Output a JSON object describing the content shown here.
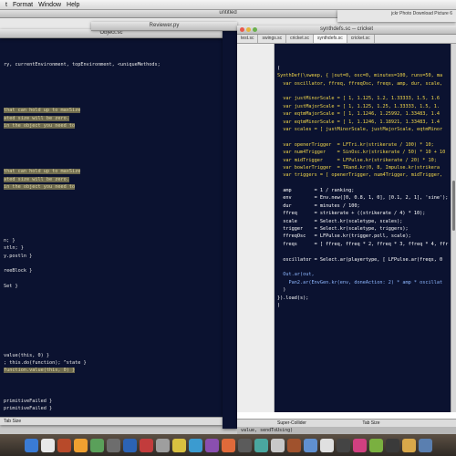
{
  "menu": [
    "t",
    "Format",
    "Window",
    "Help"
  ],
  "background_title": "untitled",
  "right_background_title": "jckr Photo Download  Picture 6",
  "object_window": {
    "title": "Object.sc",
    "lines": [
      {
        "text": "ry, currentEnvironment, topEnvironment, <uniqueMethods;",
        "cls": ""
      },
      {
        "text": "",
        "cls": ""
      },
      {
        "text": "",
        "cls": ""
      },
      {
        "text": "",
        "cls": ""
      },
      {
        "text": "",
        "cls": ""
      },
      {
        "text": "",
        "cls": ""
      },
      {
        "text": "that can hold up to maxSize",
        "cls": "hl"
      },
      {
        "text": "ated size will be zero.",
        "cls": "hl"
      },
      {
        "text": "in the object you need to",
        "cls": "hl"
      },
      {
        "text": "",
        "cls": ""
      },
      {
        "text": "",
        "cls": ""
      },
      {
        "text": "",
        "cls": ""
      },
      {
        "text": "",
        "cls": ""
      },
      {
        "text": "",
        "cls": ""
      },
      {
        "text": "that can hold up to maxSize",
        "cls": "hl"
      },
      {
        "text": "ated size will be zero.",
        "cls": "hl"
      },
      {
        "text": "in the object you need to",
        "cls": "hl"
      },
      {
        "text": "",
        "cls": ""
      },
      {
        "text": "",
        "cls": ""
      },
      {
        "text": "",
        "cls": ""
      },
      {
        "text": "",
        "cls": ""
      },
      {
        "text": "",
        "cls": ""
      },
      {
        "text": "",
        "cls": ""
      },
      {
        "text": "n; }",
        "cls": ""
      },
      {
        "text": "stln; }",
        "cls": ""
      },
      {
        "text": "y.postln }",
        "cls": ""
      },
      {
        "text": "",
        "cls": ""
      },
      {
        "text": "reeBlock }",
        "cls": ""
      },
      {
        "text": "",
        "cls": ""
      },
      {
        "text": "Set }",
        "cls": ""
      },
      {
        "text": "",
        "cls": ""
      },
      {
        "text": "",
        "cls": ""
      },
      {
        "text": "",
        "cls": ""
      },
      {
        "text": "",
        "cls": ""
      },
      {
        "text": "",
        "cls": ""
      },
      {
        "text": "",
        "cls": ""
      },
      {
        "text": "",
        "cls": ""
      },
      {
        "text": "",
        "cls": ""
      },
      {
        "text": "value(this, 0) }",
        "cls": ""
      },
      {
        "text": "; this.do(function); ^state }",
        "cls": ""
      },
      {
        "text": "function.value(this, 0) }",
        "cls": "hl"
      },
      {
        "text": "",
        "cls": ""
      },
      {
        "text": "",
        "cls": ""
      },
      {
        "text": "",
        "cls": ""
      },
      {
        "text": "primitiveFailed }",
        "cls": ""
      },
      {
        "text": "primitiveFailed }",
        "cls": ""
      }
    ],
    "status": "Tab Size"
  },
  "reviewer_title": "Reviewer.py",
  "synth_window": {
    "title": "synthdefs.sc -- cricket",
    "tabs": [
      "test.sc",
      "swings.sc",
      "cricket.sc",
      "synthdefs.sc",
      "cricket.sc"
    ],
    "active_tab": 3,
    "lines": [
      {
        "text": "(",
        "cls": "white"
      },
      {
        "text": "SynthDef(\\sweep, { |out=0, osc=0, minutes=100, runs=50, ma",
        "cls": "yellow"
      },
      {
        "text": "  var oscillator, ffreq, ffreqOsc, freqs, amp, dur, scale,",
        "cls": "yellow"
      },
      {
        "text": "",
        "cls": ""
      },
      {
        "text": "  var justMinorScale = [ 1, 1.125, 1.2, 1.33333, 1.5, 1.6",
        "cls": "yellow"
      },
      {
        "text": "  var justMajorScale = [ 1, 1.125, 1.25, 1.33333, 1.5, 1.",
        "cls": "yellow"
      },
      {
        "text": "  var eqtmMajorScale = [ 1, 1.1246, 1.25992, 1.33483, 1.4",
        "cls": "yellow"
      },
      {
        "text": "  var eqtmMinorScale = [ 1, 1.1246, 1.18921, 1.33483, 1.4",
        "cls": "yellow"
      },
      {
        "text": "  var scales = [ justMinorScale, justMajorScale, eqtmMinor",
        "cls": "yellow"
      },
      {
        "text": "",
        "cls": ""
      },
      {
        "text": "  var openerTrigger  = LFTri.kr(strikerate / 100) * 10;",
        "cls": "yellow"
      },
      {
        "text": "  var num4Trigger    = SinOsc.kr(strikerate / 50) * 10 + 10",
        "cls": "yellow"
      },
      {
        "text": "  var midTrigger     = LFPulse.kr(strikerate / 20) * 10;",
        "cls": "yellow"
      },
      {
        "text": "  var bowlerTrigger  = TRand.kr(0, 8, Impulse.kr(strikera",
        "cls": "yellow"
      },
      {
        "text": "  var triggers = [ openerTrigger, num4Trigger, midTrigger,",
        "cls": "yellow"
      },
      {
        "text": "",
        "cls": ""
      },
      {
        "text": "  amp        = 1 / ranking;",
        "cls": "white"
      },
      {
        "text": "  env        = Env.new([0, 0.8, 1, 0], [0.1, 2, 1], 'sine');",
        "cls": "white"
      },
      {
        "text": "  dur        = minutes / 100;",
        "cls": "white"
      },
      {
        "text": "  ffreq      = strikerate + ((strikerate / 4) * 10);",
        "cls": "white"
      },
      {
        "text": "  scale      = Select.kr(scaletype, scales);",
        "cls": "white"
      },
      {
        "text": "  trigger    = Select.kr(scaletype, triggers);",
        "cls": "white"
      },
      {
        "text": "  ffreqOsc   = LFPulse.kr(trigger.poll, scale);",
        "cls": "white"
      },
      {
        "text": "  freqs      = [ ffreq, ffreq * 2, ffreq * 3, ffreq * 4, ffr",
        "cls": "white"
      },
      {
        "text": "",
        "cls": ""
      },
      {
        "text": "  oscillator = Select.ar(playertype, [ LFPulse.ar(freqs, 0",
        "cls": "white"
      },
      {
        "text": "",
        "cls": ""
      },
      {
        "text": "  Out.ar(out,",
        "cls": "blue"
      },
      {
        "text": "    Pan2.ar(EnvGen.kr(env, doneAction: 2) * amp * oscillat",
        "cls": "blue"
      },
      {
        "text": "  )",
        "cls": "white"
      },
      {
        "text": "}).load(s);",
        "cls": "white"
      },
      {
        "text": ")",
        "cls": "white"
      }
    ],
    "status": "Super-Collider",
    "status2": "Tab Size"
  },
  "bottom_strip": "value, sendToUsing)"
}
